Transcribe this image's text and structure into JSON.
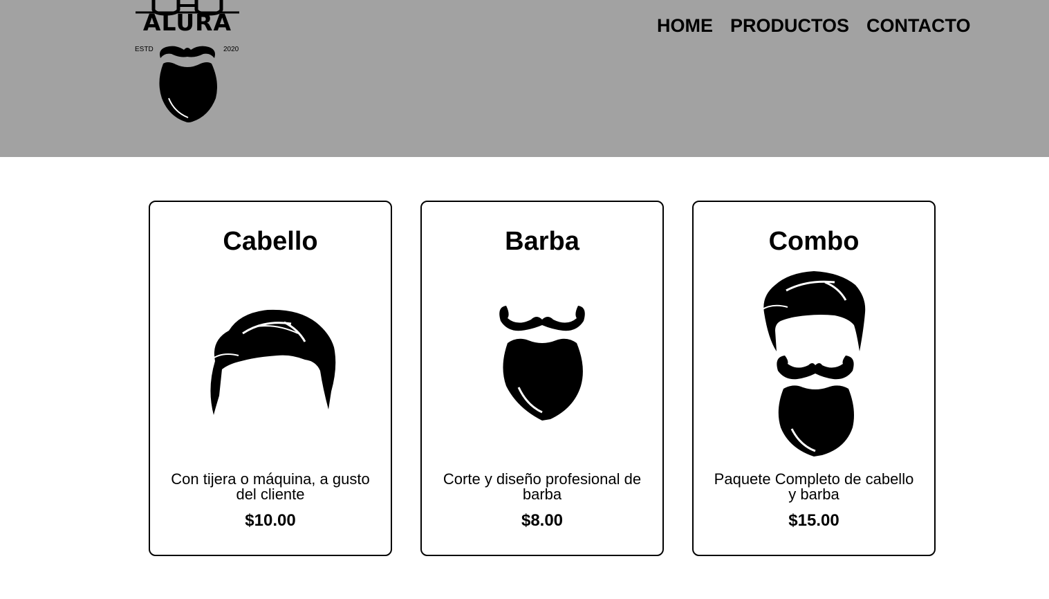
{
  "header": {
    "logo": {
      "text": "ALURA",
      "est": "ESTD",
      "year": "2020"
    },
    "nav": [
      {
        "label": "HOME"
      },
      {
        "label": "PRODUCTOS"
      },
      {
        "label": "CONTACTO"
      }
    ],
    "background": "#a2a2a2"
  },
  "products": [
    {
      "title": "Cabello",
      "icon": "hair-icon",
      "description": "Con tijera o máquina, a gusto del cliente",
      "price": "$10.00"
    },
    {
      "title": "Barba",
      "icon": "beard-icon",
      "description": "Corte y diseño profesional de barba",
      "price": "$8.00"
    },
    {
      "title": "Combo",
      "icon": "hair-and-beard-icon",
      "description": "Paquete Completo de cabello y barba",
      "price": "$15.00"
    }
  ]
}
